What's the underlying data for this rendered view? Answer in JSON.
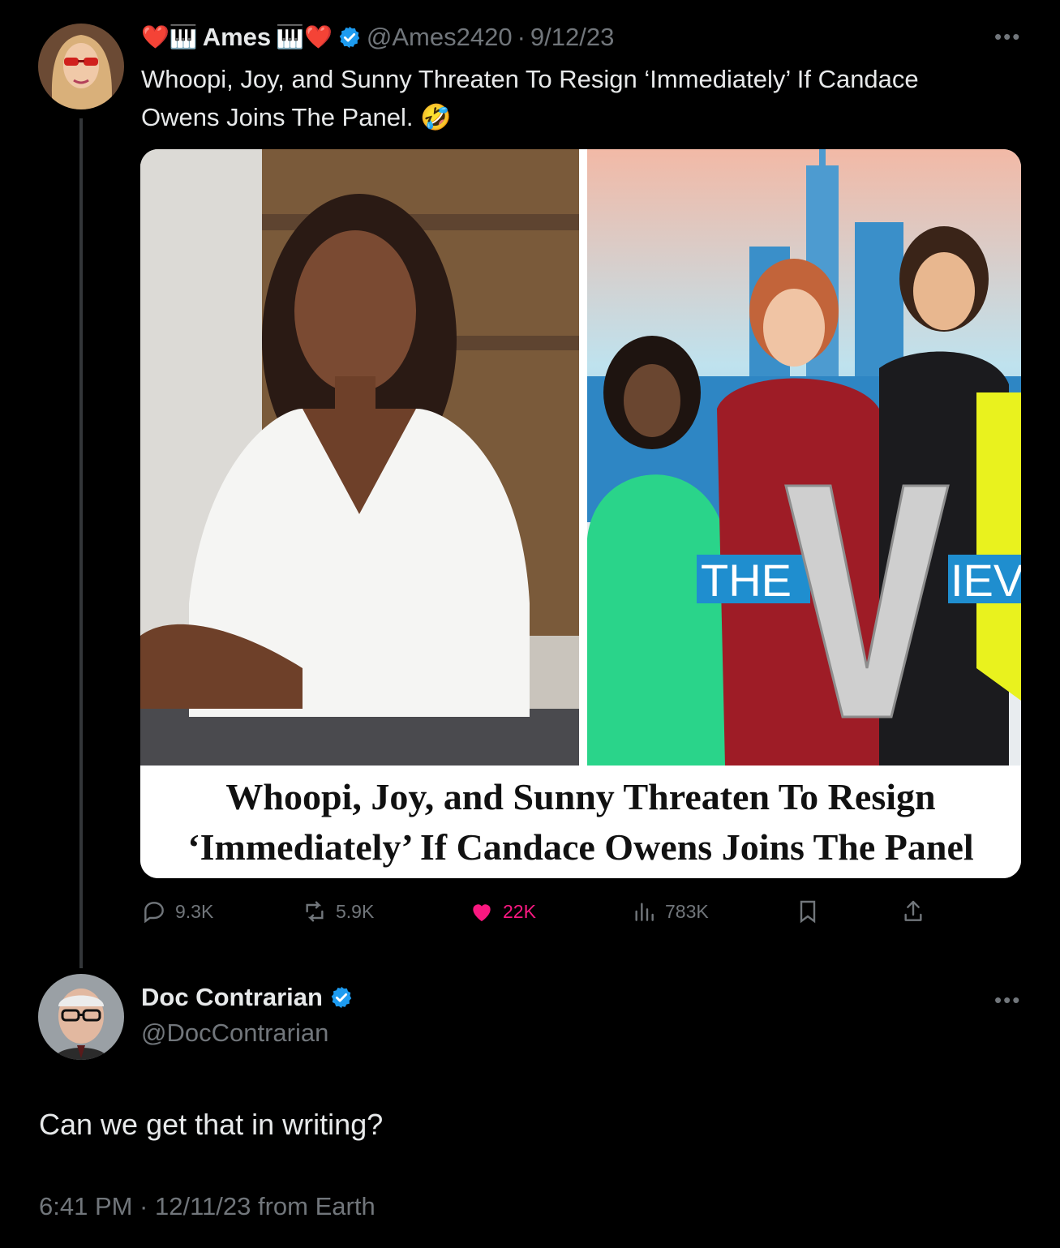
{
  "colors": {
    "background": "#000000",
    "text": "#e7e9ea",
    "muted": "#71767b",
    "verified": "#1d9bf0",
    "like": "#f91880"
  },
  "original_tweet": {
    "display_name": "Ames",
    "name_emoji_left": "❤️🎹",
    "name_emoji_right": "🎹❤️",
    "handle": "@Ames2420",
    "separator": "·",
    "date": "9/12/23",
    "more_icon": "more-icon",
    "text_line1": "Whoopi, Joy, and Sunny Threaten To Resign ‘Immediately’ If Candace",
    "text_line2": "Owens Joins The Panel. 🤣",
    "media": {
      "logo_text_left": "THE",
      "logo_letter": "V",
      "logo_text_right": "IEV",
      "caption_line1": "Whoopi, Joy, and Sunny Threaten To Resign",
      "caption_line2": "‘Immediately’ If Candace Owens Joins The Panel"
    },
    "actions": {
      "replies": "9.3K",
      "reposts": "5.9K",
      "likes": "22K",
      "views": "783K"
    }
  },
  "reply": {
    "display_name": "Doc Contrarian",
    "handle": "@DocContrarian",
    "text": "Can we get that in writing?",
    "timestamp": "6:41 PM · 12/11/23 from Earth"
  }
}
